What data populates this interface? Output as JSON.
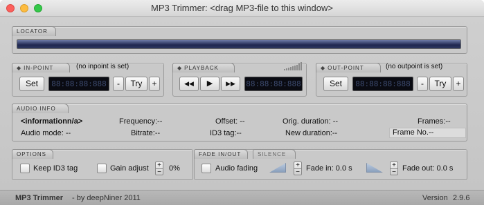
{
  "window": {
    "title": "MP3 Trimmer: <drag MP3-file to this window>"
  },
  "locator": {
    "tab_label": "LOCATOR"
  },
  "in_point": {
    "tab_label": "IN-POINT",
    "status": "(no inpoint is set)",
    "set_label": "Set",
    "display": "88:88:88:888",
    "minus_label": "-",
    "try_label": "Try",
    "plus_label": "+"
  },
  "playback": {
    "tab_label": "PLAYBACK",
    "rewind_icon": "rewind-icon",
    "play_icon": "play-icon",
    "forward_icon": "fast-forward-icon",
    "rewind_glyph": "◀◀",
    "play_glyph": "▶",
    "forward_glyph": "▶▶",
    "display": "88:88:88:888",
    "volume_icon": "volume-bars-icon"
  },
  "out_point": {
    "tab_label": "OUT-POINT",
    "status": "(no outpoint is set)",
    "set_label": "Set",
    "display": "88:88:88:888",
    "minus_label": "-",
    "try_label": "Try",
    "plus_label": "+"
  },
  "audio_info": {
    "tab_label": "AUDIO INFO",
    "info_value": "<informationn/a>",
    "audio_mode": "Audio mode: --",
    "frequency": "Frequency:--",
    "bitrate": "Bitrate:--",
    "offset": "Offset: --",
    "id3_tag": "ID3 tag:--",
    "orig_duration": "Orig. duration: --",
    "new_duration": "New duration:--",
    "frames": "Frames:--",
    "frame_no": "Frame No.--"
  },
  "options": {
    "tab_label": "OPTIONS",
    "keep_id3": "Keep ID3 tag",
    "gain_adjust": "Gain  adjust",
    "gain_value": "0%",
    "stepper_plus": "+",
    "stepper_minus": "−"
  },
  "fade": {
    "tab_label": "FADE IN/OUT",
    "tab_silence": "SILENCE",
    "audio_fading": "Audio  fading",
    "fade_in": "Fade in: 0.0 s",
    "fade_out": "Fade out: 0.0 s"
  },
  "footer": {
    "app_name": "MP3 Trimmer",
    "credit": "- by  deepNiner  2011",
    "version_label": "Version",
    "version": "2.9.6"
  },
  "colors": {
    "lcd_background": "#0a0b12",
    "lcd_digits": "#3c4a6e",
    "locator_bar": "#2e3860",
    "close_button": "#fc605c",
    "minimize_button": "#fdbc40",
    "maximize_button": "#34c84a"
  }
}
